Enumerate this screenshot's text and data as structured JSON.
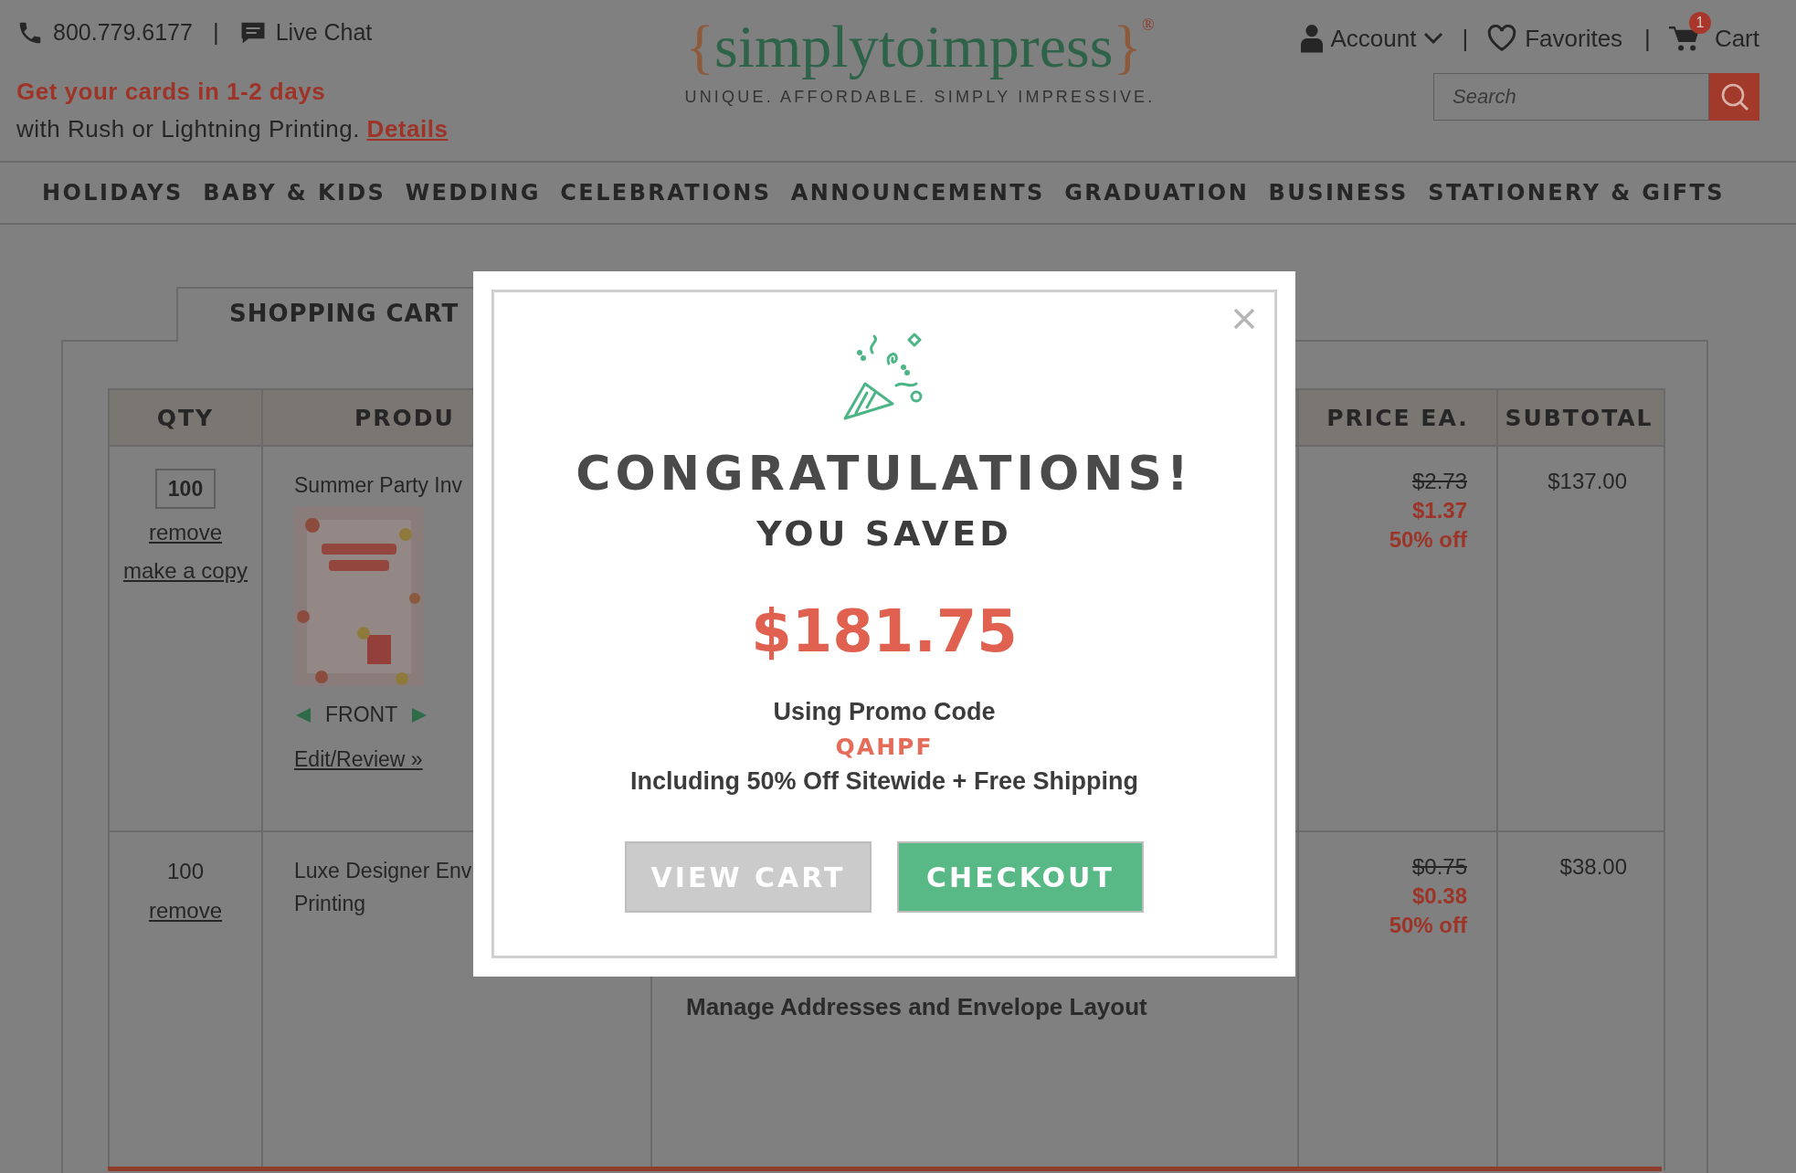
{
  "header": {
    "phone": "800.779.6177",
    "separator": "|",
    "live_chat": "Live Chat",
    "promo_headline": "Get your cards in 1-2 days",
    "promo_text": "with Rush or Lightning Printing.",
    "promo_link": "Details",
    "logo": {
      "open": "{",
      "name": "simplytoimpress",
      "close": "}",
      "mark": "®"
    },
    "tagline": "UNIQUE. AFFORDABLE. SIMPLY IMPRESSIVE.",
    "account": "Account",
    "favorites": "Favorites",
    "separators": [
      "|",
      "|"
    ],
    "cart": "Cart",
    "cart_count": "1",
    "search": {
      "placeholder": "Search"
    }
  },
  "nav": [
    "HOLIDAYS",
    "BABY & KIDS",
    "WEDDING",
    "CELEBRATIONS",
    "ANNOUNCEMENTS",
    "GRADUATION",
    "BUSINESS",
    "STATIONERY & GIFTS"
  ],
  "cart": {
    "tab": "SHOPPING CART",
    "columns": [
      "QTY",
      "PRODU",
      "PRICE EA.",
      "SUBTOTAL"
    ],
    "rows": [
      {
        "qty": "100",
        "qty_editable": true,
        "links": [
          "remove",
          "make a copy"
        ],
        "product_lines": [
          "Summer Party Inv"
        ],
        "image": {
          "kind": "picture"
        },
        "view": "FRONT",
        "edit": "Edit/Review »",
        "price_old": "$2.73",
        "price_new": "$1.37",
        "discount": "50% off",
        "subtotal": "$137.00"
      },
      {
        "qty": "100",
        "qty_editable": false,
        "links": [
          "remove"
        ],
        "product_lines": [
          "Luxe Designer Env",
          "Printing"
        ],
        "details": "Manage Addresses and Envelope Layout",
        "price_old": "$0.75",
        "price_new": "$0.38",
        "discount": "50% off",
        "subtotal": "$38.00"
      }
    ]
  },
  "modal": {
    "title": "CONGRATULATIONS!",
    "subtitle": "YOU SAVED",
    "amount": "$181.75",
    "promo_label": "Using Promo Code",
    "promo_code": "QAHPF",
    "note": "Including 50% Off Sitewide + Free Shipping",
    "buttons": [
      {
        "label": "VIEW CART",
        "kind": "secondary"
      },
      {
        "label": "CHECKOUT",
        "kind": "primary"
      }
    ]
  }
}
